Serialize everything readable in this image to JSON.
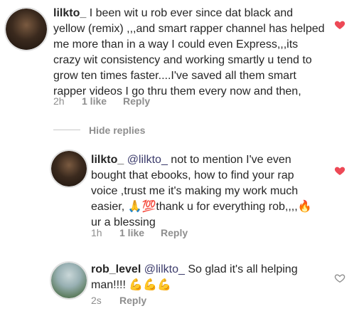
{
  "comments": [
    {
      "username": "lilkto_",
      "mention": "",
      "text": "I been wit u rob ever since dat black and yellow (remix) ,,,and smart rapper channel has helped me more than in a way I could even Express,,,its crazy wit consistency and working smartly u tend to grow ten times faster....I've saved all them smart rapper videos I go thru them every now and then,",
      "time": "2h",
      "likes": "1 like",
      "reply": "Reply",
      "liked": true
    },
    {
      "username": "lilkto_",
      "mention": "@lilkto_",
      "text": "not to mention I've even bought that ebooks, how to find  your rap voice ,trust me it's making my work much easier, 🙏💯thank u for everything rob,,,,🔥 ur a blessing",
      "time": "1h",
      "likes": "1 like",
      "reply": "Reply",
      "liked": true
    },
    {
      "username": "rob_level",
      "mention": "@lilkto_",
      "text": "So glad it's all helping man!!!! 💪💪💪",
      "time": "2s",
      "likes": "",
      "reply": "Reply",
      "liked": false
    }
  ],
  "hide_replies": "Hide replies",
  "colors": {
    "heart_liked": "#ed4956",
    "heart_empty": "#8e8e8e",
    "mention": "#3b3b6b",
    "meta": "#8e8e8e"
  }
}
